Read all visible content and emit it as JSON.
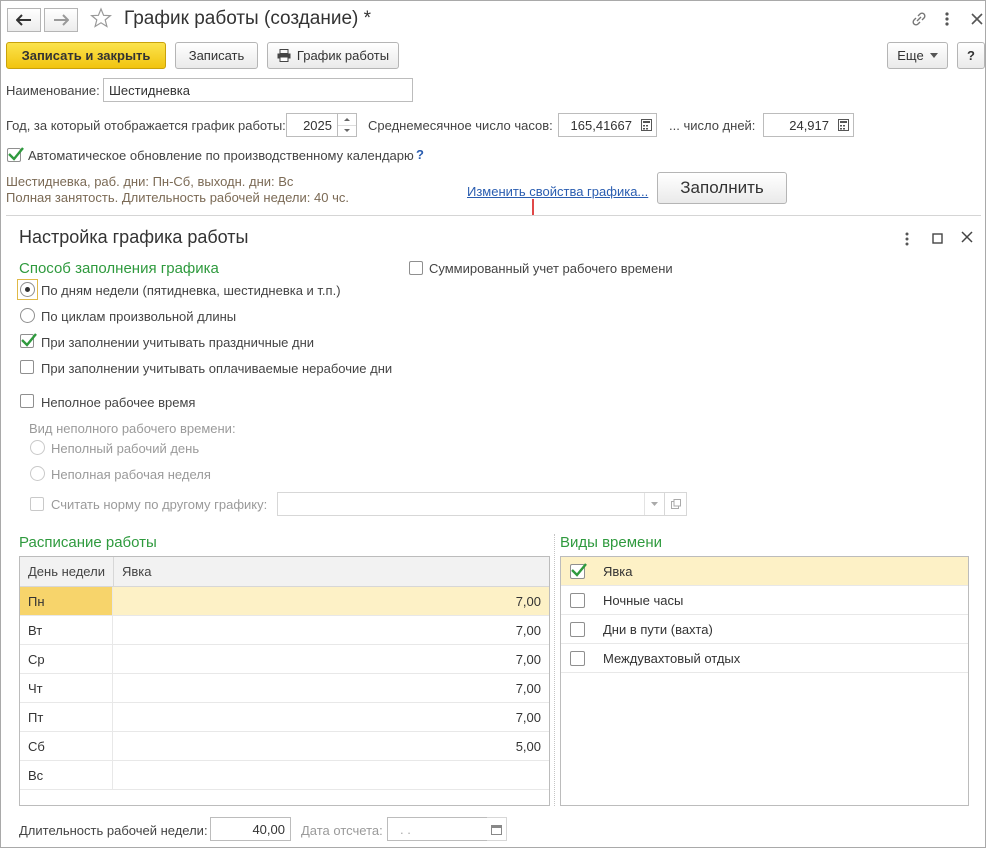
{
  "window": {
    "title": "График работы (создание) *",
    "back_label": "←",
    "forward_label": "→"
  },
  "toolbar": {
    "save_close_label": "Записать и закрыть",
    "save_label": "Записать",
    "schedule_label": "График работы",
    "more_label": "Еще",
    "help_label": "?"
  },
  "form": {
    "name_label": "Наименование:",
    "name_value": "Шестидневка",
    "year_label": "Год, за который отображается график работы:",
    "year_value": "2025",
    "avg_hours_label": "Среднемесячное число часов:",
    "avg_hours_value": "165,41667",
    "days_label": "... число дней:",
    "days_value": "24,917",
    "auto_update_label": "Автоматическое обновление по производственному календарю",
    "auto_update_checked": true,
    "help_q": "?",
    "description_line1": "Шестидневка, раб. дни: Пн-Сб, выходн. дни: Вс",
    "description_line2": "Полная занятость. Длительность рабочей недели: 40 чс.",
    "change_link": "Изменить свойства графика...",
    "fill_button": "Заполнить"
  },
  "dialog": {
    "title": "Настройка графика работы",
    "fill_method_heading": "Способ заполнения графика",
    "radio_by_weekdays": "По дням недели (пятидневка, шестидневка и т.п.)",
    "radio_by_cycles": "По циклам произвольной длины",
    "summed_accounting": "Суммированный учет рабочего времени",
    "consider_holidays": "При заполнении учитывать праздничные дни",
    "consider_holidays_checked": true,
    "consider_paid_nonworking": "При заполнении учитывать оплачиваемые нерабочие дни",
    "part_time": "Неполное рабочее время",
    "part_time_kind_label": "Вид неполного рабочего времени:",
    "part_time_day": "Неполный рабочий день",
    "part_time_week": "Неполная рабочая неделя",
    "norm_by_other": "Считать норму по другому графику:",
    "schedule_heading": "Расписание работы",
    "time_types_heading": "Виды времени",
    "columns": [
      "День недели",
      "Явка"
    ],
    "rows": [
      {
        "day": "Пн",
        "value": "7,00"
      },
      {
        "day": "Вт",
        "value": "7,00"
      },
      {
        "day": "Ср",
        "value": "7,00"
      },
      {
        "day": "Чт",
        "value": "7,00"
      },
      {
        "day": "Пт",
        "value": "7,00"
      },
      {
        "day": "Сб",
        "value": "5,00"
      },
      {
        "day": "Вс",
        "value": ""
      }
    ],
    "time_types": [
      {
        "label": "Явка",
        "checked": true
      },
      {
        "label": "Ночные часы",
        "checked": false
      },
      {
        "label": "Дни в пути (вахта)",
        "checked": false
      },
      {
        "label": "Междувахтовый отдых",
        "checked": false
      }
    ],
    "week_length_label": "Длительность рабочей недели:",
    "week_length_value": "40,00",
    "ref_date_label": "Дата отсчета:",
    "ref_date_value": ".  ."
  },
  "colors": {
    "accent_yellow": "#f1c40f",
    "heading_green": "#2f9a3e",
    "selection": "#fdf1c6",
    "arrow_red": "#e04848",
    "link_blue": "#2a5db0"
  }
}
